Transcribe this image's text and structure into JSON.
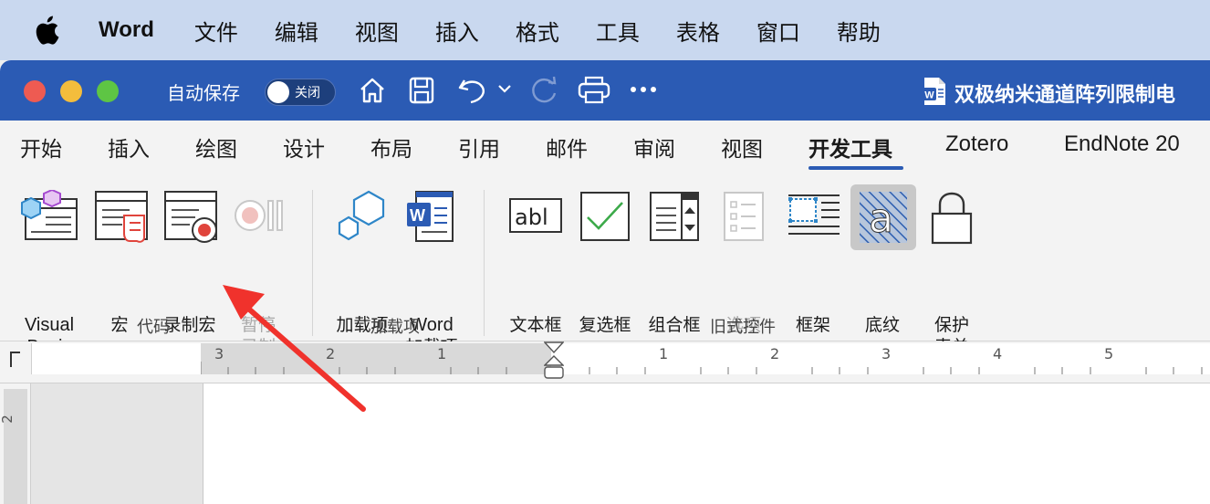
{
  "menubar": {
    "app": "Word",
    "items": [
      "文件",
      "编辑",
      "视图",
      "插入",
      "格式",
      "工具",
      "表格",
      "窗口",
      "帮助"
    ]
  },
  "titlebar": {
    "autosave_label": "自动保存",
    "autosave_state": "关闭",
    "document_title": "双极纳米通道阵列限制电"
  },
  "tabs": {
    "items": [
      "开始",
      "插入",
      "绘图",
      "设计",
      "布局",
      "引用",
      "邮件",
      "审阅",
      "视图",
      "开发工具",
      "Zotero",
      "EndNote 20"
    ],
    "active": "开发工具"
  },
  "ribbon": {
    "code_group": {
      "label": "代码",
      "visual_basic": [
        "Visual",
        "Basic"
      ],
      "macros": "宏",
      "record_macro": "录制宏",
      "pause_recording": [
        "暂停",
        "录制"
      ]
    },
    "addins_group": {
      "label": "加载项",
      "addins": "加载项",
      "word_addins": [
        "Word",
        "加载项"
      ]
    },
    "legacy_group": {
      "label": "旧式控件",
      "text_box": "文本框",
      "check_box": "复选框",
      "combo_box": "组合框",
      "options": "选项",
      "frame": "框架",
      "shading": "底纹",
      "protect_form": [
        "保护",
        "表单"
      ]
    }
  },
  "ruler": {
    "left_numbers": [
      "3",
      "2",
      "1"
    ],
    "right_numbers": [
      "1",
      "2",
      "3",
      "4",
      "5"
    ],
    "vertical_number": "2"
  },
  "colors": {
    "titlebar": "#2b5bb4",
    "menubar": "#c9d8ef",
    "accent": "#2b5bb4",
    "arrow": "#f0322c"
  }
}
